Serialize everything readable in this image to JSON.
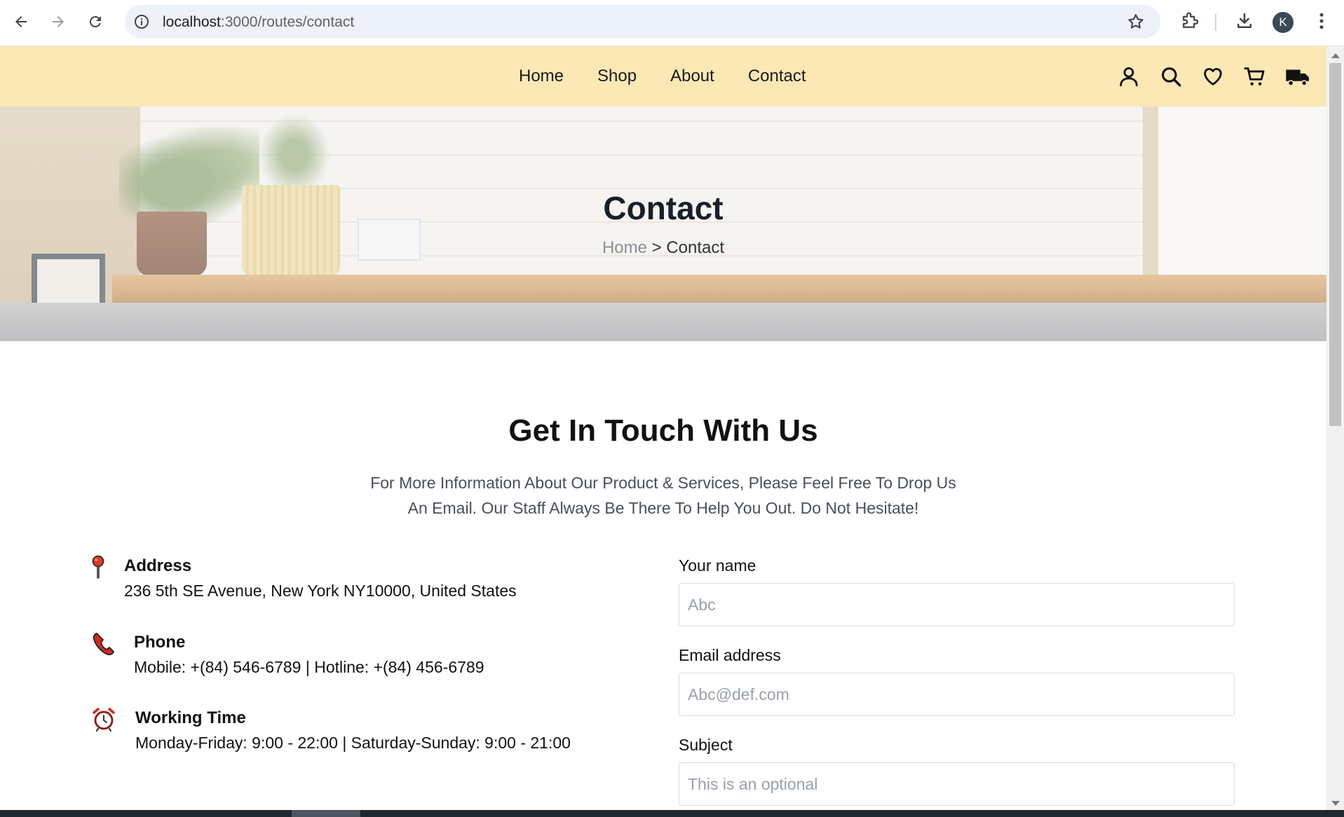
{
  "browser": {
    "url_host": "localhost",
    "url_path": ":3000/routes/contact",
    "profile_initial": "K",
    "icons": [
      "back-arrow-icon",
      "forward-arrow-icon",
      "reload-icon",
      "site-info-icon",
      "bookmark-star-icon",
      "extensions-icon",
      "download-icon",
      "more-vert-icon"
    ]
  },
  "header": {
    "menu": [
      {
        "label": "Home"
      },
      {
        "label": "Shop"
      },
      {
        "label": "About"
      },
      {
        "label": "Contact"
      }
    ],
    "icons": [
      "user-icon",
      "search-icon",
      "heart-icon",
      "cart-icon",
      "truck-icon"
    ],
    "background_color": "#fbe8b4"
  },
  "banner": {
    "title": "Contact",
    "breadcrumb_home": "Home",
    "breadcrumb_sep": " > ",
    "breadcrumb_current": "Contact"
  },
  "contact": {
    "heading": "Get In Touch With Us",
    "description_line1": "For More Information About Our Product & Services, Please Feel Free To Drop Us",
    "description_line2": "An Email. Our Staff Always Be There To Help You Out. Do Not Hesitate!",
    "info": [
      {
        "icon": "map-pin-icon",
        "title": "Address",
        "text": "236 5th SE Avenue, New York NY10000, United States"
      },
      {
        "icon": "phone-icon",
        "title": "Phone",
        "text": "Mobile: +(84) 546-6789 | Hotline: +(84) 456-6789"
      },
      {
        "icon": "alarm-clock-icon",
        "title": "Working Time",
        "text": "Monday-Friday: 9:00 - 22:00 | Saturday-Sunday: 9:00 - 21:00"
      }
    ],
    "form": {
      "name_label": "Your name",
      "name_placeholder": "Abc",
      "email_label": "Email address",
      "email_placeholder": "Abc@def.com",
      "subject_label": "Subject",
      "subject_placeholder": "This is an optional"
    }
  }
}
